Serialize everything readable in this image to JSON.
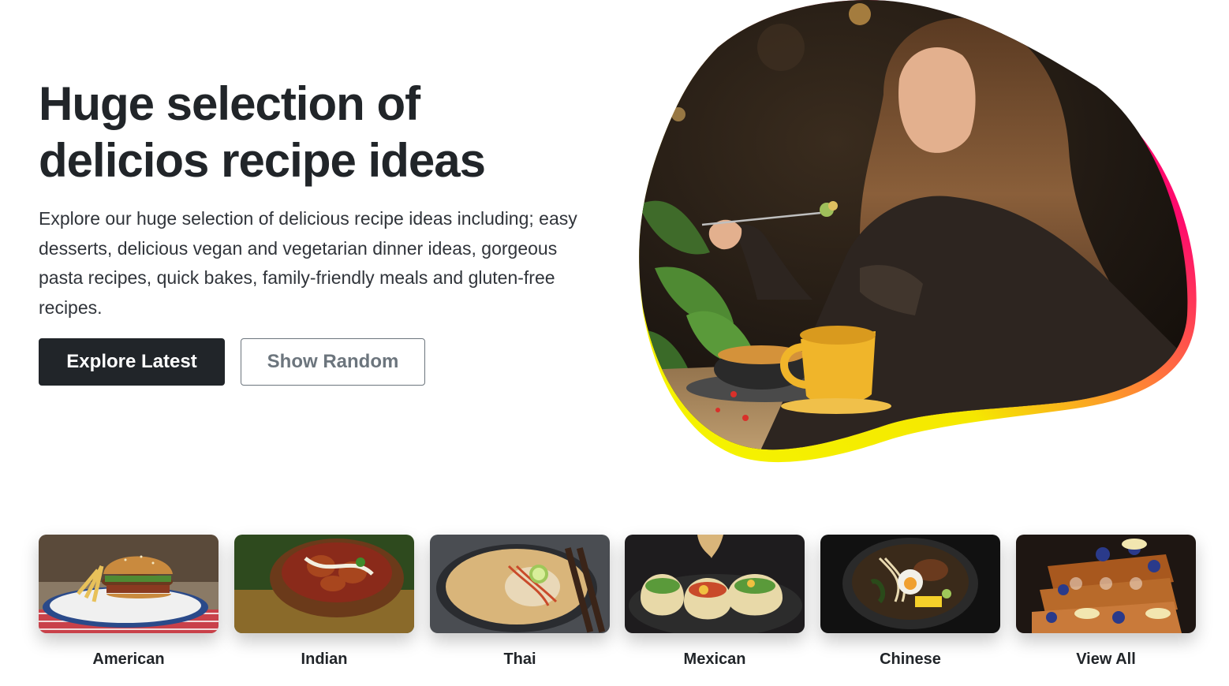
{
  "hero": {
    "title_line1": "Huge selection of",
    "title_line2": "delicios recipe ideas",
    "lead": "Explore our huge selection of delicious recipe ideas including; easy desserts, delicious vegan and vegetarian dinner ideas, gorgeous pasta recipes, quick bakes, family-friendly meals and gluten-free recipes.",
    "primary_button": "Explore Latest",
    "secondary_button": "Show Random",
    "image_icon": "woman-eating-photo"
  },
  "categories": [
    {
      "label": "American",
      "icon": "burger-photo"
    },
    {
      "label": "Indian",
      "icon": "curry-photo"
    },
    {
      "label": "Thai",
      "icon": "thai-soup-photo"
    },
    {
      "label": "Mexican",
      "icon": "tacos-photo"
    },
    {
      "label": "Chinese",
      "icon": "noodle-bowl-photo"
    },
    {
      "label": "View All",
      "icon": "french-toast-photo"
    }
  ],
  "colors": {
    "dark": "#212529",
    "muted": "#6c757d",
    "accent_pink": "#ff0a6c",
    "accent_yellow": "#f5f500"
  }
}
